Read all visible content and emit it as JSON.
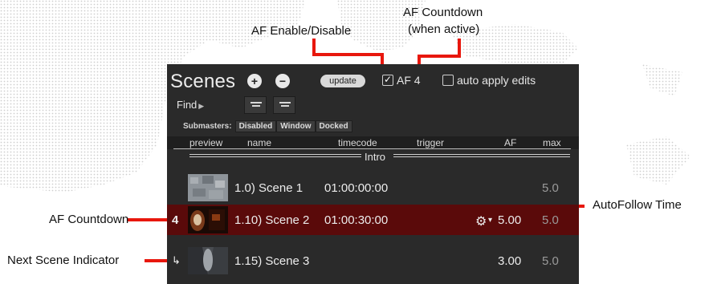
{
  "annotations": {
    "af_enable": "AF Enable/Disable",
    "af_countdown_top_line1": "AF Countdown",
    "af_countdown_top_line2": "(when active)",
    "autofollow_time": "AutoFollow Time",
    "af_countdown_left": "AF Countdown",
    "next_scene_indicator": "Next Scene Indicator"
  },
  "panel": {
    "title": "Scenes",
    "add_glyph": "+",
    "remove_glyph": "−",
    "update_label": "update",
    "af_checkbox": {
      "checked": true,
      "label": "AF 4"
    },
    "auto_apply": {
      "checked": false,
      "label": "auto apply edits"
    },
    "find_label": "Find",
    "find_arrow": "▶",
    "submasters": {
      "label": "Submasters:",
      "options": [
        "Disabled",
        "Window",
        "Docked"
      ]
    },
    "columns": [
      "preview",
      "name",
      "timecode",
      "trigger",
      "AF",
      "max"
    ],
    "group_name": "Intro",
    "rows": [
      {
        "indicator": "",
        "name": "1.0) Scene 1",
        "timecode": "01:00:00:00",
        "trigger_icon": "",
        "af": "",
        "max": "5.0",
        "active": false
      },
      {
        "indicator": "4",
        "name": "1.10) Scene 2",
        "timecode": "01:00:30:00",
        "trigger_icon": "gear-icon",
        "af": "5.00",
        "max": "5.0",
        "active": true
      },
      {
        "indicator": "↳",
        "name": "1.15) Scene 3",
        "timecode": "",
        "trigger_icon": "",
        "af": "3.00",
        "max": "5.0",
        "active": false
      }
    ]
  },
  "colors": {
    "panel_bg": "#2a2a2a",
    "active_row": "#5a0a0a",
    "annotation_red": "#e8170d"
  }
}
